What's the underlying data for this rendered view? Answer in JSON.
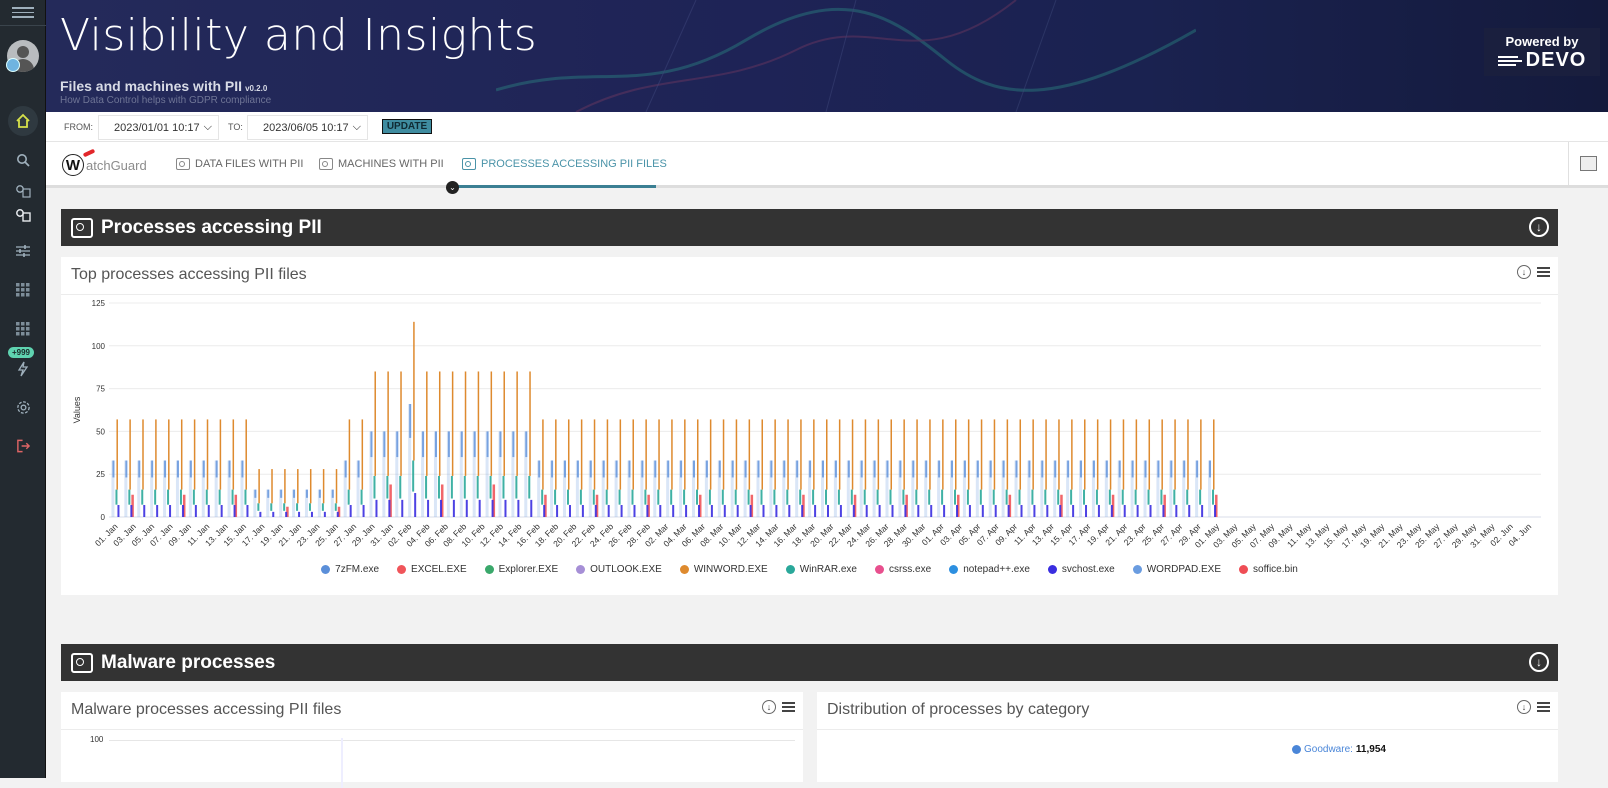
{
  "sidebar": {
    "items": [
      {
        "name": "menu",
        "icon": "hamburger-icon"
      },
      {
        "name": "user",
        "icon": "avatar-icon"
      },
      {
        "name": "home",
        "icon": "home-icon",
        "active": true
      },
      {
        "name": "search",
        "icon": "search-icon"
      },
      {
        "name": "queries",
        "icon": "query-icon"
      },
      {
        "name": "queries-saved",
        "icon": "query-saved-icon"
      },
      {
        "name": "filters",
        "icon": "sliders-icon"
      },
      {
        "name": "apps",
        "icon": "grid-icon"
      },
      {
        "name": "apps-2",
        "icon": "grid-icon"
      },
      {
        "name": "alerts",
        "icon": "lightning-icon"
      },
      {
        "name": "settings",
        "icon": "gear-icon"
      },
      {
        "name": "logout",
        "icon": "logout-icon"
      }
    ],
    "alerts_badge": "+999",
    "home_color": "#d6e14a"
  },
  "header": {
    "title": "Visibility and Insights",
    "subtitle": "Files and machines with PII",
    "version": "v0.2.0",
    "tagline": "How Data Control helps with GDPR compliance",
    "powered_by": "Powered by",
    "brand": "DEVO"
  },
  "filters": {
    "from_label": "FROM:",
    "from_value": "2023/01/01 10:17",
    "to_label": "TO:",
    "to_value": "2023/06/05 10:17",
    "update_label": "UPDATE"
  },
  "tabs": {
    "logo": "atchGuard",
    "logo_letter": "W",
    "items": [
      {
        "label": "DATA FILES WITH PII",
        "active": false
      },
      {
        "label": "MACHINES WITH PII",
        "active": false
      },
      {
        "label": "PROCESSES ACCESSING PII FILES",
        "active": true
      }
    ],
    "accent": "#3b7f93"
  },
  "sections": {
    "processes": {
      "title": "Processes accessing PII"
    },
    "malware": {
      "title": "Malware processes"
    }
  },
  "panels": {
    "top_processes": {
      "title": "Top processes accessing PII files"
    },
    "malware_processes": {
      "title": "Malware processes accessing PII files",
      "y_top_tick": "100"
    },
    "distribution": {
      "title": "Distribution of processes by category",
      "legend": [
        {
          "label": "Goodware:",
          "value": "11,954",
          "color": "#4a86d8"
        }
      ]
    }
  },
  "chart_data": {
    "type": "bar",
    "title": "Top processes accessing PII files",
    "xlabel": "",
    "ylabel": "Values",
    "ylim": [
      0,
      125
    ],
    "yticks": [
      0,
      25,
      50,
      75,
      100,
      125
    ],
    "grid": true,
    "legend_position": "bottom",
    "x_tick_labels": [
      "01. Jan",
      "03. Jan",
      "05. Jan",
      "07. Jan",
      "09. Jan",
      "11. Jan",
      "13. Jan",
      "15. Jan",
      "17. Jan",
      "19. Jan",
      "21. Jan",
      "23. Jan",
      "25. Jan",
      "27. Jan",
      "29. Jan",
      "31. Jan",
      "02. Feb",
      "04. Feb",
      "06. Feb",
      "08. Feb",
      "10. Feb",
      "12. Feb",
      "14. Feb",
      "16. Feb",
      "18. Feb",
      "20. Feb",
      "22. Feb",
      "24. Feb",
      "26. Feb",
      "28. Feb",
      "02. Mar",
      "04. Mar",
      "06. Mar",
      "08. Mar",
      "10. Mar",
      "12. Mar",
      "14. Mar",
      "16. Mar",
      "18. Mar",
      "20. Mar",
      "22. Mar",
      "24. Mar",
      "26. Mar",
      "28. Mar",
      "30. Mar",
      "01. Apr",
      "03. Apr",
      "05. Apr",
      "07. Apr",
      "09. Apr",
      "11. Apr",
      "13. Apr",
      "15. Apr",
      "17. Apr",
      "19. Apr",
      "21. Apr",
      "23. Apr",
      "25. Apr",
      "27. Apr",
      "29. Apr",
      "01. May",
      "03. May",
      "05. May",
      "07. May",
      "09. May",
      "11. May",
      "13. May",
      "15. May",
      "17. May",
      "19. May",
      "21. May",
      "23. May",
      "25. May",
      "27. May",
      "29. May",
      "31. May",
      "02. Jun",
      "04. Jun"
    ],
    "series": [
      {
        "name": "7zFM.exe",
        "color": "#5b8fd9"
      },
      {
        "name": "EXCEL.EXE",
        "color": "#f0555a"
      },
      {
        "name": "Explorer.EXE",
        "color": "#3aa86b"
      },
      {
        "name": "OUTLOOK.EXE",
        "color": "#a68fd6"
      },
      {
        "name": "WINWORD.EXE",
        "color": "#de8a2e"
      },
      {
        "name": "WinRAR.exe",
        "color": "#2aa89a"
      },
      {
        "name": "csrss.exe",
        "color": "#e8508e"
      },
      {
        "name": "notepad++.exe",
        "color": "#2c8fe0"
      },
      {
        "name": "svchost.exe",
        "color": "#3a2ee0"
      },
      {
        "name": "WORDPAD.EXE",
        "color": "#6a9ce0"
      },
      {
        "name": "soffice.bin",
        "color": "#ef4d55"
      }
    ],
    "groups_note": "per-day values for the main series",
    "segments": [
      {
        "days": 11,
        "WINWORD.EXE": 57,
        "7zFM.exe": 33,
        "WinRAR.exe": 16,
        "svchost.exe": 7,
        "EXCEL.EXE": 13
      },
      {
        "days": 7,
        "WINWORD.EXE": 28,
        "7zFM.exe": 16,
        "WinRAR.exe": 8,
        "svchost.exe": 3,
        "EXCEL.EXE": 6
      },
      {
        "days": 2,
        "WINWORD.EXE": 57,
        "7zFM.exe": 33,
        "WinRAR.exe": 16,
        "svchost.exe": 7,
        "EXCEL.EXE": 13
      },
      {
        "days": 3,
        "WINWORD.EXE": 85,
        "7zFM.exe": 50,
        "WinRAR.exe": 24,
        "svchost.exe": 10,
        "EXCEL.EXE": 19
      },
      {
        "days": 1,
        "WINWORD.EXE": 114,
        "7zFM.exe": 66,
        "WinRAR.exe": 33,
        "svchost.exe": 14,
        "EXCEL.EXE": 25
      },
      {
        "days": 9,
        "WINWORD.EXE": 85,
        "7zFM.exe": 50,
        "WinRAR.exe": 24,
        "svchost.exe": 10,
        "EXCEL.EXE": 19
      },
      {
        "days": 53,
        "WINWORD.EXE": 57,
        "7zFM.exe": 33,
        "WinRAR.exe": 16,
        "svchost.exe": 7,
        "EXCEL.EXE": 13
      },
      {
        "days": 25,
        "WINWORD.EXE": 0,
        "7zFM.exe": 0,
        "WinRAR.exe": 0,
        "svchost.exe": 0,
        "EXCEL.EXE": 0
      }
    ]
  }
}
